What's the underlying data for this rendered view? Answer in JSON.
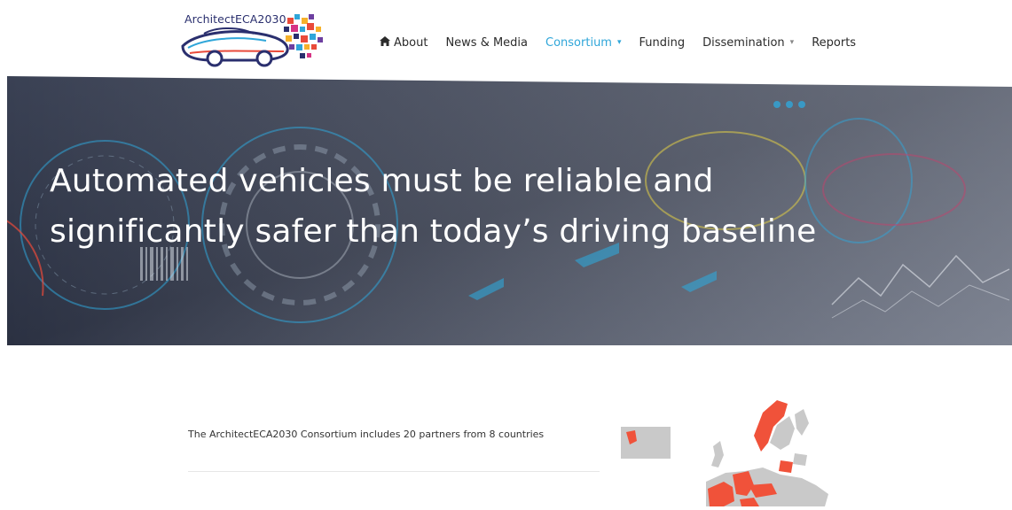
{
  "header": {
    "logo_text": "ArchitectECA2030",
    "nav": [
      {
        "label": "About",
        "icon": "home-icon"
      },
      {
        "label": "News & Media"
      },
      {
        "label": "Consortium",
        "active": true,
        "dropdown": true
      },
      {
        "label": "Funding"
      },
      {
        "label": "Dissemination",
        "dropdown": true
      },
      {
        "label": "Reports"
      }
    ]
  },
  "hero": {
    "line1": "Automated vehicles must be reliable and",
    "line2": "significantly safer than today’s driving baseline"
  },
  "consortium": {
    "text": "The ArchitectECA2030 Consortium includes 20 partners from 8 countries"
  },
  "colors": {
    "accent": "#2fa6d9",
    "map_highlight": "#f0523a",
    "map_base": "#c9c9c9",
    "hero_bg": "#2e3445"
  }
}
